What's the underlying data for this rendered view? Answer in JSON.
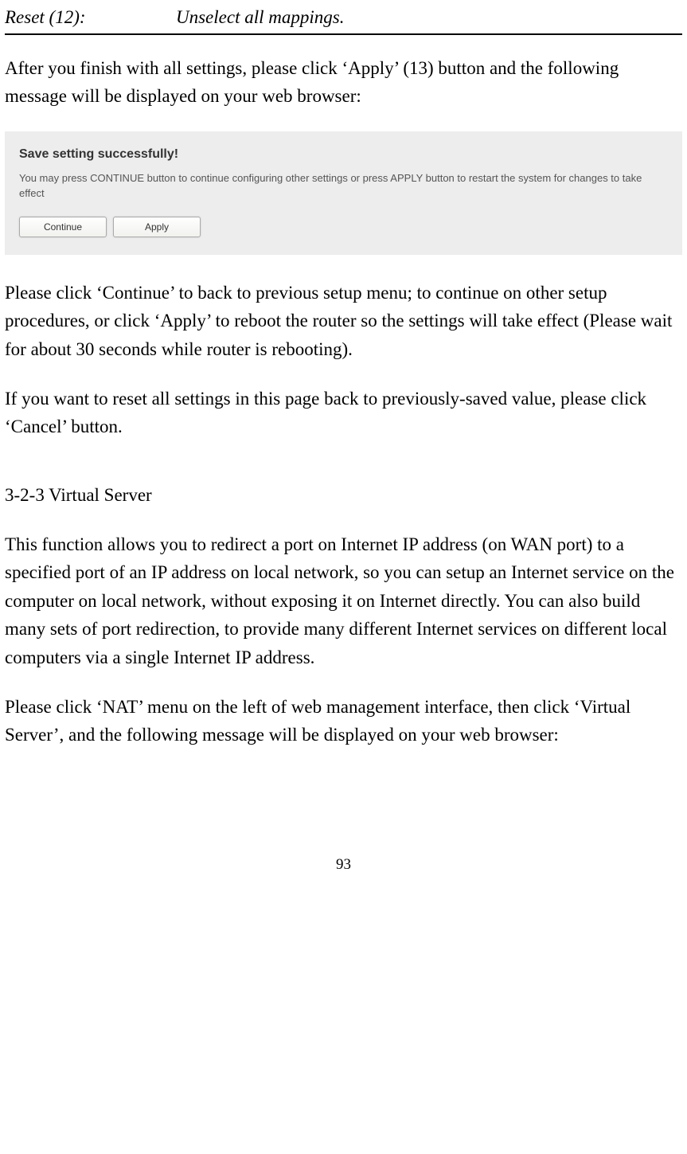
{
  "definition": {
    "term": "Reset (12):",
    "desc": "Unselect all mappings."
  },
  "para1": "After you finish with all settings, please click ‘Apply’ (13) button and the following message will be displayed on your web browser:",
  "screenshot": {
    "title": "Save setting successfully!",
    "text": "You may press CONTINUE button to continue configuring other settings or press APPLY button to restart the system for changes to take effect",
    "continue_label": "Continue",
    "apply_label": "Apply"
  },
  "para2": "Please click ‘Continue’ to back to previous setup menu; to continue on other setup procedures, or click ‘Apply’ to reboot the router so the settings will take effect (Please wait for about 30 seconds while router is rebooting).",
  "para3": "If you want to reset all settings in this page back to previously-saved value, please click ‘Cancel’ button.",
  "section_heading": "3-2-3 Virtual Server",
  "para4": "This function allows you to redirect a port on Internet IP address (on WAN port) to a specified port of an IP address on local network, so you can setup an Internet service on the computer on local network, without exposing it on Internet directly. You can also build many sets of port redirection, to provide many different Internet services on different local computers via a single Internet IP address.",
  "para5": "Please click ‘NAT’ menu on the left of web management interface, then click ‘Virtual Server’, and the following message will be displayed on your web browser:",
  "page_number": "93"
}
